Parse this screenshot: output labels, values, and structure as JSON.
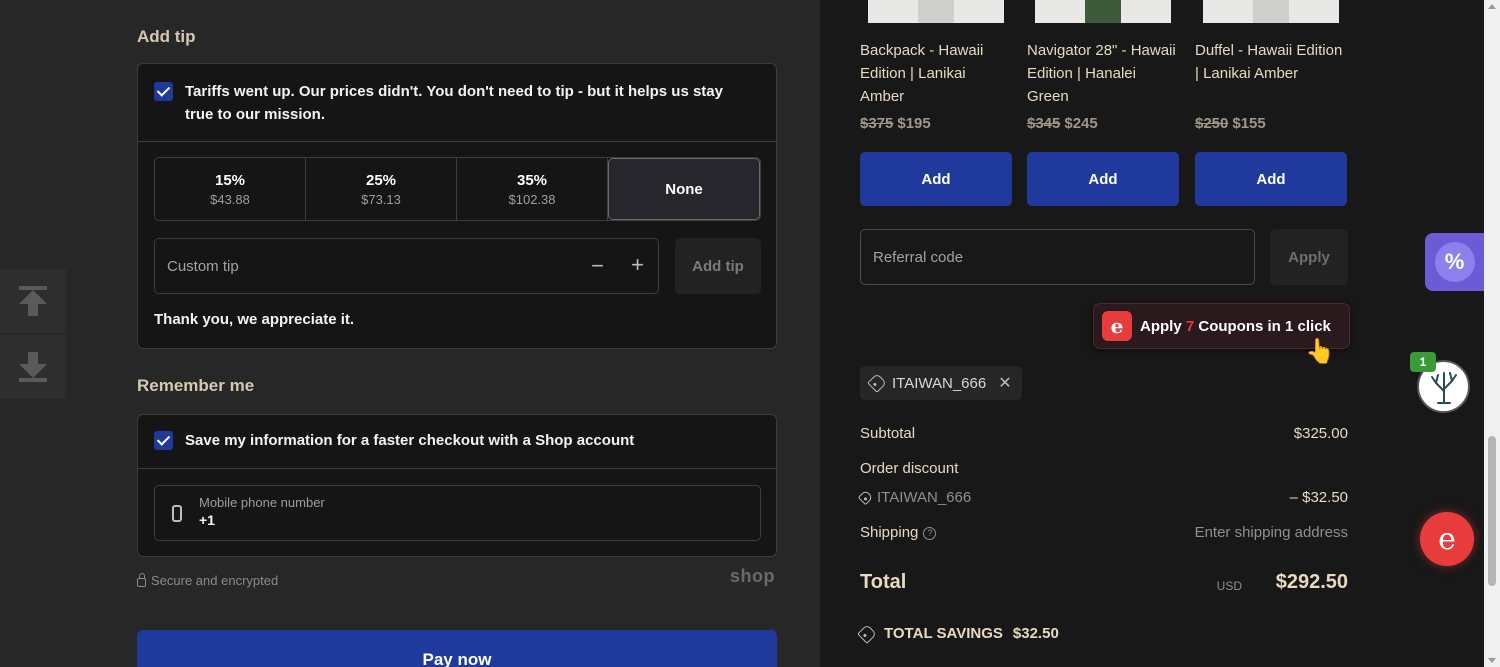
{
  "tip": {
    "title": "Add tip",
    "message": "Tariffs went up. Our prices didn't. You don't need to tip - but it helps us stay true to our mission.",
    "options": [
      {
        "pct": "15%",
        "amount": "$43.88"
      },
      {
        "pct": "25%",
        "amount": "$73.13"
      },
      {
        "pct": "35%",
        "amount": "$102.38"
      }
    ],
    "none_label": "None",
    "custom_placeholder": "Custom tip",
    "minus": "−",
    "plus": "+",
    "add_label": "Add tip",
    "thanks": "Thank you, we appreciate it."
  },
  "remember": {
    "title": "Remember me",
    "save_info": "Save my information for a faster checkout with a Shop account",
    "phone_label": "Mobile phone number",
    "phone_value": "+1"
  },
  "footer": {
    "secure": "Secure and encrypted",
    "shop_logo": "shop",
    "pay_label": "Pay now"
  },
  "products": [
    {
      "name": "Backpack - Hawaii Edition | Lanikai Amber",
      "old_price": "$375",
      "price": "$195",
      "add": "Add"
    },
    {
      "name": "Navigator 28\" - Hawaii Edition | Hanalei Green",
      "old_price": "$345",
      "price": "$245",
      "add": "Add"
    },
    {
      "name": "Duffel - Hawaii Edition | Lanikai Amber",
      "old_price": "$250",
      "price": "$155",
      "add": "Add"
    }
  ],
  "referral": {
    "placeholder": "Referral code",
    "apply": "Apply"
  },
  "coupon_popup": {
    "prefix": "Apply",
    "count": "7",
    "suffix": "Coupons in 1 click"
  },
  "discount_chip": "ITAIWAN_666",
  "summary": {
    "subtotal_label": "Subtotal",
    "subtotal_value": "$325.00",
    "order_discount_label": "Order discount",
    "discount_code": "ITAIWAN_666",
    "discount_value": "– $32.50",
    "shipping_label": "Shipping",
    "shipping_value": "Enter shipping address",
    "total_label": "Total",
    "currency": "USD",
    "total_value": "$292.50",
    "savings_label": "TOTAL SAVINGS",
    "savings_value": "$32.50"
  },
  "extensions": {
    "tree_badge": "1",
    "percent_icon": "%",
    "float_logo": "e"
  }
}
